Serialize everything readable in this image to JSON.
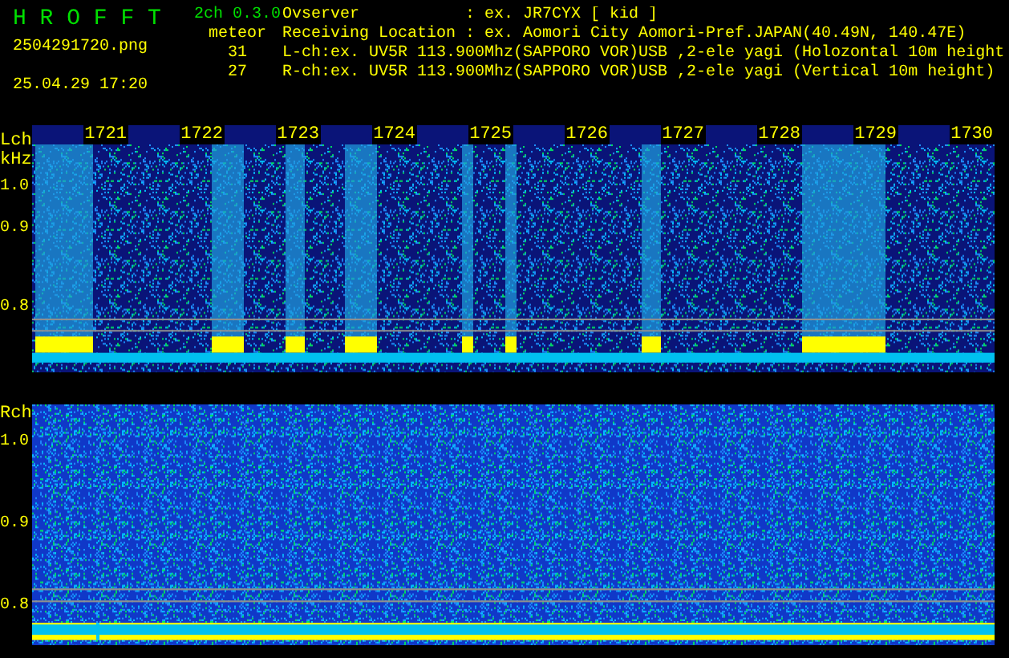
{
  "app": {
    "title": "H R O F F T",
    "version": "2ch 0.3.0"
  },
  "file": {
    "name": "2504291720.png",
    "datetime": "25.04.29 17:20"
  },
  "meteor": {
    "label": "meteor",
    "counts": [
      "31",
      "27"
    ]
  },
  "info": [
    "Ovserver           : ex. JR7CYX [ kid ]",
    "Receiving Location : ex. Aomori City Aomori-Pref.JAPAN(40.49N, 140.47E)",
    "L-ch:ex. UV5R 113.900Mhz(SAPPORO VOR)USB ,2-ele yagi (Holozontal 10m height",
    "R-ch:ex. UV5R 113.900Mhz(SAPPORO VOR)USB ,2-ele yagi (Vertical 10m height)"
  ],
  "channels": [
    {
      "kind": "left",
      "label": "Lch",
      "unit": "kHz",
      "ticks": [
        "1.0",
        "0.9",
        "0.8"
      ],
      "times": [
        "1721",
        "1722",
        "1723",
        "1724",
        "1725",
        "1726",
        "1727",
        "1728",
        "1729",
        "1730"
      ]
    },
    {
      "kind": "right",
      "label": "Rch",
      "ticks": [
        "1.0",
        "0.9",
        "0.8"
      ]
    }
  ]
}
